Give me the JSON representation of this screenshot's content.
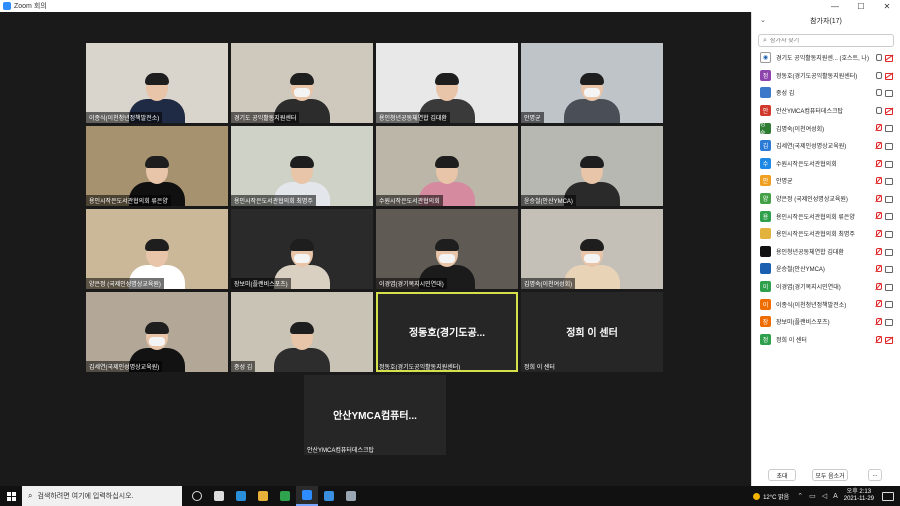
{
  "window": {
    "title": "Zoom 회의",
    "minimize": "—",
    "maximize": "☐",
    "close": "✕"
  },
  "gallery": {
    "tiles": [
      {
        "name": "이종식(이천청년정책발전소)",
        "bg": "#d9d4cc",
        "body": "#1f2a44",
        "hair": true,
        "mask": false
      },
      {
        "name": "경기도 공익활동지원센터",
        "bg": "#cfc8bd",
        "body": "#2c2c2c",
        "hair": true,
        "mask": true
      },
      {
        "name": "용인청년공동체연합 김대환",
        "bg": "#e8e8e8",
        "body": "#3a3a3a",
        "hair": true,
        "mask": false
      },
      {
        "name": "안명균",
        "bg": "#bfc4c9",
        "body": "#4a4f57",
        "hair": true,
        "mask": true
      },
      {
        "name": "용인시작은도서관협의회 류은양",
        "bg": "#a7926f",
        "body": "#101010",
        "hair": true,
        "mask": false
      },
      {
        "name": "용인시작은도서관협의회 최명주",
        "bg": "#cfd3c7",
        "body": "#e3e6ea",
        "hair": true,
        "mask": false
      },
      {
        "name": "수원시작은도서관협의회",
        "bg": "#bcb6a9",
        "body": "#d58aa0",
        "hair": true,
        "mask": false
      },
      {
        "name": "윤승철(안산YMCA)",
        "bg": "#b8b8b3",
        "body": "#2a2a2a",
        "hair": true,
        "mask": false
      },
      {
        "name": "양은정 (국제인성명상교육원)",
        "bg": "#cbb898",
        "body": "#ffffff",
        "hair": true,
        "mask": false
      },
      {
        "name": "장보미(플랜비스포츠)",
        "bg": "#2a2a2a",
        "body": "#d9d0c2",
        "hair": true,
        "mask": true
      },
      {
        "name": "이경엽(경기복지시민연대)",
        "bg": "#5f5a53",
        "body": "#1b1b1b",
        "hair": true,
        "mask": true
      },
      {
        "name": "김명숙(이천여성회)",
        "bg": "#c4c0b8",
        "body": "#e9d3b7",
        "hair": true,
        "mask": true
      },
      {
        "name": "김세연(국제인성명상교육원)",
        "bg": "#b3a898",
        "body": "#121212",
        "hair": true,
        "mask": true
      },
      {
        "name": "중성 김",
        "bg": "#c9c3b5",
        "body": "#2d2d2d",
        "hair": true,
        "mask": false
      }
    ],
    "text_tiles": [
      {
        "big": "정동호(경기도공...",
        "name": "정동호(경기도공익활동지원센터)"
      },
      {
        "big": "정희 이 센터",
        "name": "정희 이 센터"
      },
      {
        "big": "안산YMCA컴퓨터...",
        "name": "안산YMCA컴퓨터데스크탑"
      }
    ]
  },
  "panel": {
    "title": "참가자(17)",
    "collapse_icon": "chevron-down-icon",
    "search_placeholder": "참가자 찾기",
    "participants": [
      {
        "name": "경기도 공익활동지원센... (호스트, 나)",
        "initial": "",
        "color": "#ffffff",
        "logo": true,
        "mic": "on",
        "cam": "off"
      },
      {
        "name": "정동호(경기도공익활동지원센터)",
        "initial": "정",
        "color": "#8e44ad",
        "mic": "on",
        "cam": "off"
      },
      {
        "name": "중성 김",
        "initial": "",
        "color": "#3b78c9",
        "mic": "on",
        "cam": "on"
      },
      {
        "name": "안산YMCA컴퓨터데스크탑",
        "initial": "안",
        "color": "#d0392b",
        "mic": "on",
        "cam": "off"
      },
      {
        "name": "김명숙(이천여성회)",
        "initial": "명숙",
        "color": "#2e7d32",
        "mic": "muted",
        "cam": "on"
      },
      {
        "name": "김세연(국제인성명상교육원)",
        "initial": "김",
        "color": "#2b7bd6",
        "mic": "muted",
        "cam": "on"
      },
      {
        "name": "수원시작은도서관협의회",
        "initial": "수",
        "color": "#1e88e5",
        "mic": "muted",
        "cam": "on"
      },
      {
        "name": "안명균",
        "initial": "안",
        "color": "#f0a020",
        "mic": "muted",
        "cam": "on"
      },
      {
        "name": "양은정 (국제인성명상교육원)",
        "initial": "양",
        "color": "#43a047",
        "mic": "muted",
        "cam": "on"
      },
      {
        "name": "용인시작은도서관협의회 류은양",
        "initial": "용",
        "color": "#2e9f4a",
        "mic": "muted",
        "cam": "on"
      },
      {
        "name": "용인시작은도서관협의회 최명주",
        "initial": "",
        "color": "#e3b23c",
        "mic": "muted",
        "cam": "on"
      },
      {
        "name": "용인청년공동체연합 김대환",
        "initial": "",
        "color": "#111111",
        "mic": "muted",
        "cam": "on"
      },
      {
        "name": "윤승철(안산YMCA)",
        "initial": "",
        "color": "#1b5fb0",
        "mic": "muted",
        "cam": "on"
      },
      {
        "name": "이경엽(경기복지시민연대)",
        "initial": "이",
        "color": "#2e9f4a",
        "mic": "muted",
        "cam": "on"
      },
      {
        "name": "이종식(이천청년정책발전소)",
        "initial": "이",
        "color": "#ef6c00",
        "mic": "muted",
        "cam": "on"
      },
      {
        "name": "장보미(플랜비스포츠)",
        "initial": "장",
        "color": "#ef6c00",
        "mic": "muted",
        "cam": "on"
      },
      {
        "name": "정희 이 센터",
        "initial": "정",
        "color": "#2e9f4a",
        "mic": "muted",
        "cam": "off"
      }
    ],
    "footer": {
      "invite": "초대",
      "mute_all": "모두 음소거",
      "more": "..."
    }
  },
  "taskbar": {
    "search_text": "검색하려면 여기에 입력하십시오.",
    "apps": [
      "task-view-icon",
      "file-explorer-icon",
      "edge-icon",
      "folder-icon",
      "chrome-icon",
      "zoom-icon",
      "store-icon",
      "app-icon"
    ],
    "weather": "12°C 맑음",
    "time": "오후 2:13",
    "date": "2021-11-29",
    "ime": "A"
  }
}
